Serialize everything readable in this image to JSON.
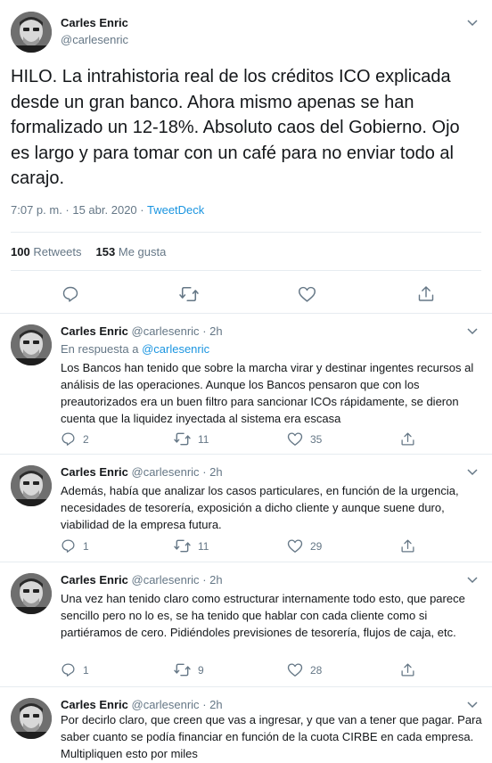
{
  "main_tweet": {
    "author_name": "Carles Enric",
    "author_handle": "@carlesenric",
    "text": "HILO. La intrahistoria real de los créditos ICO explicada desde un gran banco. Ahora mismo apenas se han formalizado un 12-18%. Absoluto caos del Gobierno. Ojo es largo y para tomar con un café para no enviar todo al carajo.",
    "timestamp": "7:07 p. m. · 15 abr. 2020",
    "separator": " · ",
    "source": "TweetDeck",
    "retweets_count": "100",
    "retweets_label": "Retweets",
    "likes_count": "153",
    "likes_label": "Me gusta"
  },
  "replies": [
    {
      "author_name": "Carles Enric",
      "author_handle": "@carlesenric",
      "time": "· 2h",
      "in_reply_prefix": "En respuesta a",
      "in_reply_handle": "@carlesenric",
      "text": "Los Bancos han tenido que sobre la marcha virar y destinar ingentes recursos al análisis de las operaciones. Aunque los Bancos pensaron que con los preautorizados era un buen filtro para sancionar ICOs rápidamente, se dieron cuenta que la liquidez inyectada al sistema era escasa",
      "reply_count": "2",
      "retweet_count": "11",
      "like_count": "35"
    },
    {
      "author_name": "Carles Enric",
      "author_handle": "@carlesenric",
      "time": "· 2h",
      "text": "Además, había que analizar los casos particulares, en función de la urgencia, necesidades de tesorería, exposición a dicho cliente y aunque suene duro, viabilidad de la empresa futura.",
      "reply_count": "1",
      "retweet_count": "11",
      "like_count": "29"
    },
    {
      "author_name": "Carles Enric",
      "author_handle": "@carlesenric",
      "time": "· 2h",
      "text": "Una vez han tenido claro como estructurar internamente todo esto, que parece sencillo pero no lo es, se ha tenido que hablar con cada cliente como si partiéramos de cero. Pidiéndoles previsiones de tesorería, flujos de caja, etc.",
      "reply_count": "1",
      "retweet_count": "9",
      "like_count": "28"
    },
    {
      "author_name": "Carles Enric",
      "author_handle": "@carlesenric",
      "time": "· 2h",
      "text": "Por decirlo claro, que creen que vas a ingresar, y que van a tener que pagar. Para saber cuanto se podía financiar en función de la cuota CIRBE en cada empresa. Multipliquen esto por miles"
    }
  ],
  "icons": {
    "reply": "reply-icon",
    "retweet": "retweet-icon",
    "like": "heart-icon",
    "share": "share-icon",
    "more": "chevron-down-icon",
    "avatar": "avatar"
  },
  "colors": {
    "text": "#14171a",
    "secondary": "#657786",
    "link": "#1b95e0",
    "border": "#e6ecf0"
  }
}
